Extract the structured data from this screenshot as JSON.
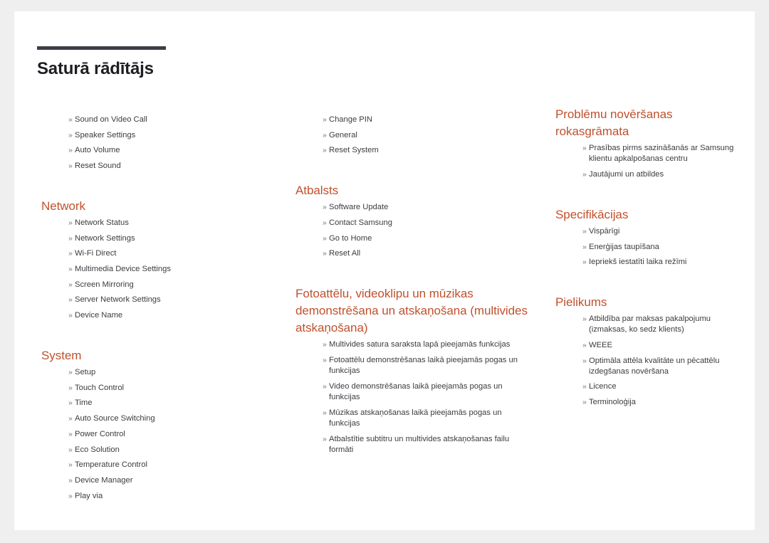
{
  "page": {
    "title": "Saturā rādītājs",
    "bullet_marker": "»",
    "accent_color": "#c0512e",
    "rule_color": "#3e3e48",
    "text_color": "#3c3c42",
    "background_color": "#efefef",
    "page_color": "#ffffff"
  },
  "columns": [
    {
      "id": "column-1",
      "sections": [
        {
          "heading": null,
          "items": [
            "Sound on Video Call",
            "Speaker Settings",
            "Auto Volume",
            "Reset Sound"
          ]
        },
        {
          "heading": "Network",
          "items": [
            "Network Status",
            "Network Settings",
            "Wi-Fi Direct",
            "Multimedia Device Settings",
            "Screen Mirroring",
            "Server Network Settings",
            "Device Name"
          ]
        },
        {
          "heading": "System",
          "items": [
            "Setup",
            "Touch Control",
            "Time",
            "Auto Source Switching",
            "Power Control",
            "Eco Solution",
            "Temperature Control",
            "Device Manager",
            "Play via"
          ]
        }
      ]
    },
    {
      "id": "column-2",
      "sections": [
        {
          "heading": null,
          "items": [
            "Change PIN",
            "General",
            "Reset System"
          ]
        },
        {
          "heading": "Atbalsts",
          "items": [
            "Software Update",
            "Contact Samsung",
            "Go to Home",
            "Reset All"
          ]
        },
        {
          "heading": "Fotoattēlu, videoklipu un mūzikas demonstrēšana un atskaņošana (multivides atskaņošana)",
          "items": [
            "Multivides satura saraksta lapā pieejamās funkcijas",
            "Fotoattēlu demonstrēšanas laikā pieejamās pogas un funkcijas",
            "Video demonstrēšanas laikā pieejamās pogas un funkcijas",
            "Mūzikas atskaņošanas laikā pieejamās pogas un funkcijas",
            "Atbalstītie subtitru un multivides atskaņošanas failu formāti"
          ]
        }
      ]
    },
    {
      "id": "column-3",
      "sections": [
        {
          "heading": "Problēmu novēršanas rokasgrāmata",
          "items": [
            "Prasības pirms sazināšanās ar Samsung klientu apkalpošanas centru",
            "Jautājumi un atbildes"
          ]
        },
        {
          "heading": "Specifikācijas",
          "items": [
            "Vispārīgi",
            "Enerģijas taupīšana",
            "Iepriekš iestatīti laika režīmi"
          ]
        },
        {
          "heading": "Pielikums",
          "items": [
            "Atbildība par maksas pakalpojumu (izmaksas, ko sedz klients)",
            "WEEE",
            "Optimāla attēla kvalitāte un pēcattēlu izdegšanas novēršana",
            "Licence",
            "Terminoloģija"
          ]
        }
      ]
    }
  ]
}
